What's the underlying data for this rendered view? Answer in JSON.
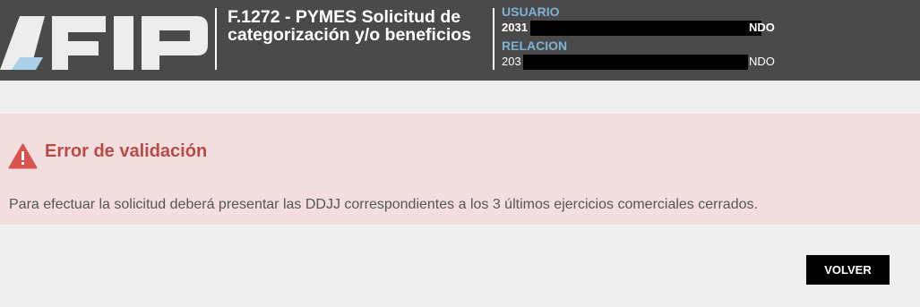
{
  "header": {
    "title": "F.1272 - PYMES Solicitud de categorización y/o beneficios",
    "logo_icon": "afip-logo-icon",
    "user_label": "USUARIO",
    "user_value": "2031",
    "user_value_suffix": "NDO",
    "relation_label": "RELACION",
    "relation_value": "203",
    "relation_value_suffix": "NDO"
  },
  "alert": {
    "icon": "warning-triangle-icon",
    "title": "Error de validación",
    "message": "Para efectuar la solicitud deberá presentar las DDJJ correspondientes a los 3 últimos ejercicios comerciales cerrados."
  },
  "actions": {
    "volver_label": "VOLVER"
  },
  "colors": {
    "header_bg": "#4a4a4a",
    "label_blue": "#7fb2d4",
    "alert_bg": "#f2dede",
    "alert_title": "#b94a48",
    "warning_icon": "#d9534f",
    "page_bg": "#eeeeee",
    "button_bg": "#000000"
  }
}
